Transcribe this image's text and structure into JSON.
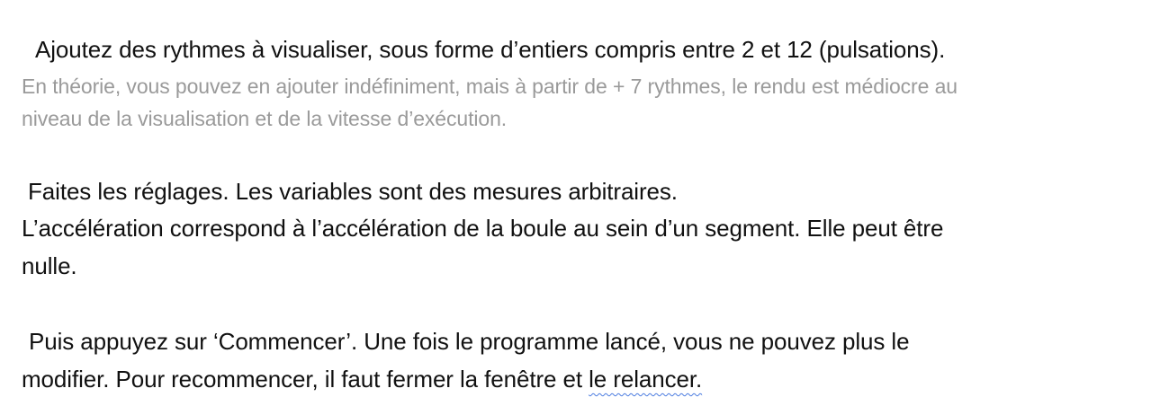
{
  "section1": {
    "main": "Ajoutez des rythmes à visualiser, sous forme d’entiers compris entre 2 et 12 (pulsations).",
    "note_line1": "En théorie, vous pouvez en ajouter indéfiniment, mais à partir de + 7 rythmes, le rendu est médiocre au",
    "note_line2": "niveau de la visualisation et de la vitesse d’exécution."
  },
  "section2": {
    "line1": "Faites les réglages. Les variables sont des mesures arbitraires.",
    "line2": "L’accélération correspond à l’accélération de la boule au sein d’un segment. Elle peut être",
    "line3": "nulle."
  },
  "section3": {
    "line1": "Puis appuyez sur ‘Commencer’. Une fois le programme lancé, vous ne pouvez plus le",
    "line2_start": "modifier. Pour recommencer, il faut fermer la fenêtre et ",
    "line2_flagged": "le relancer."
  },
  "colors": {
    "text": "#111111",
    "muted": "#9a9a9a",
    "spellcheck_underline": "#4a7be0"
  }
}
